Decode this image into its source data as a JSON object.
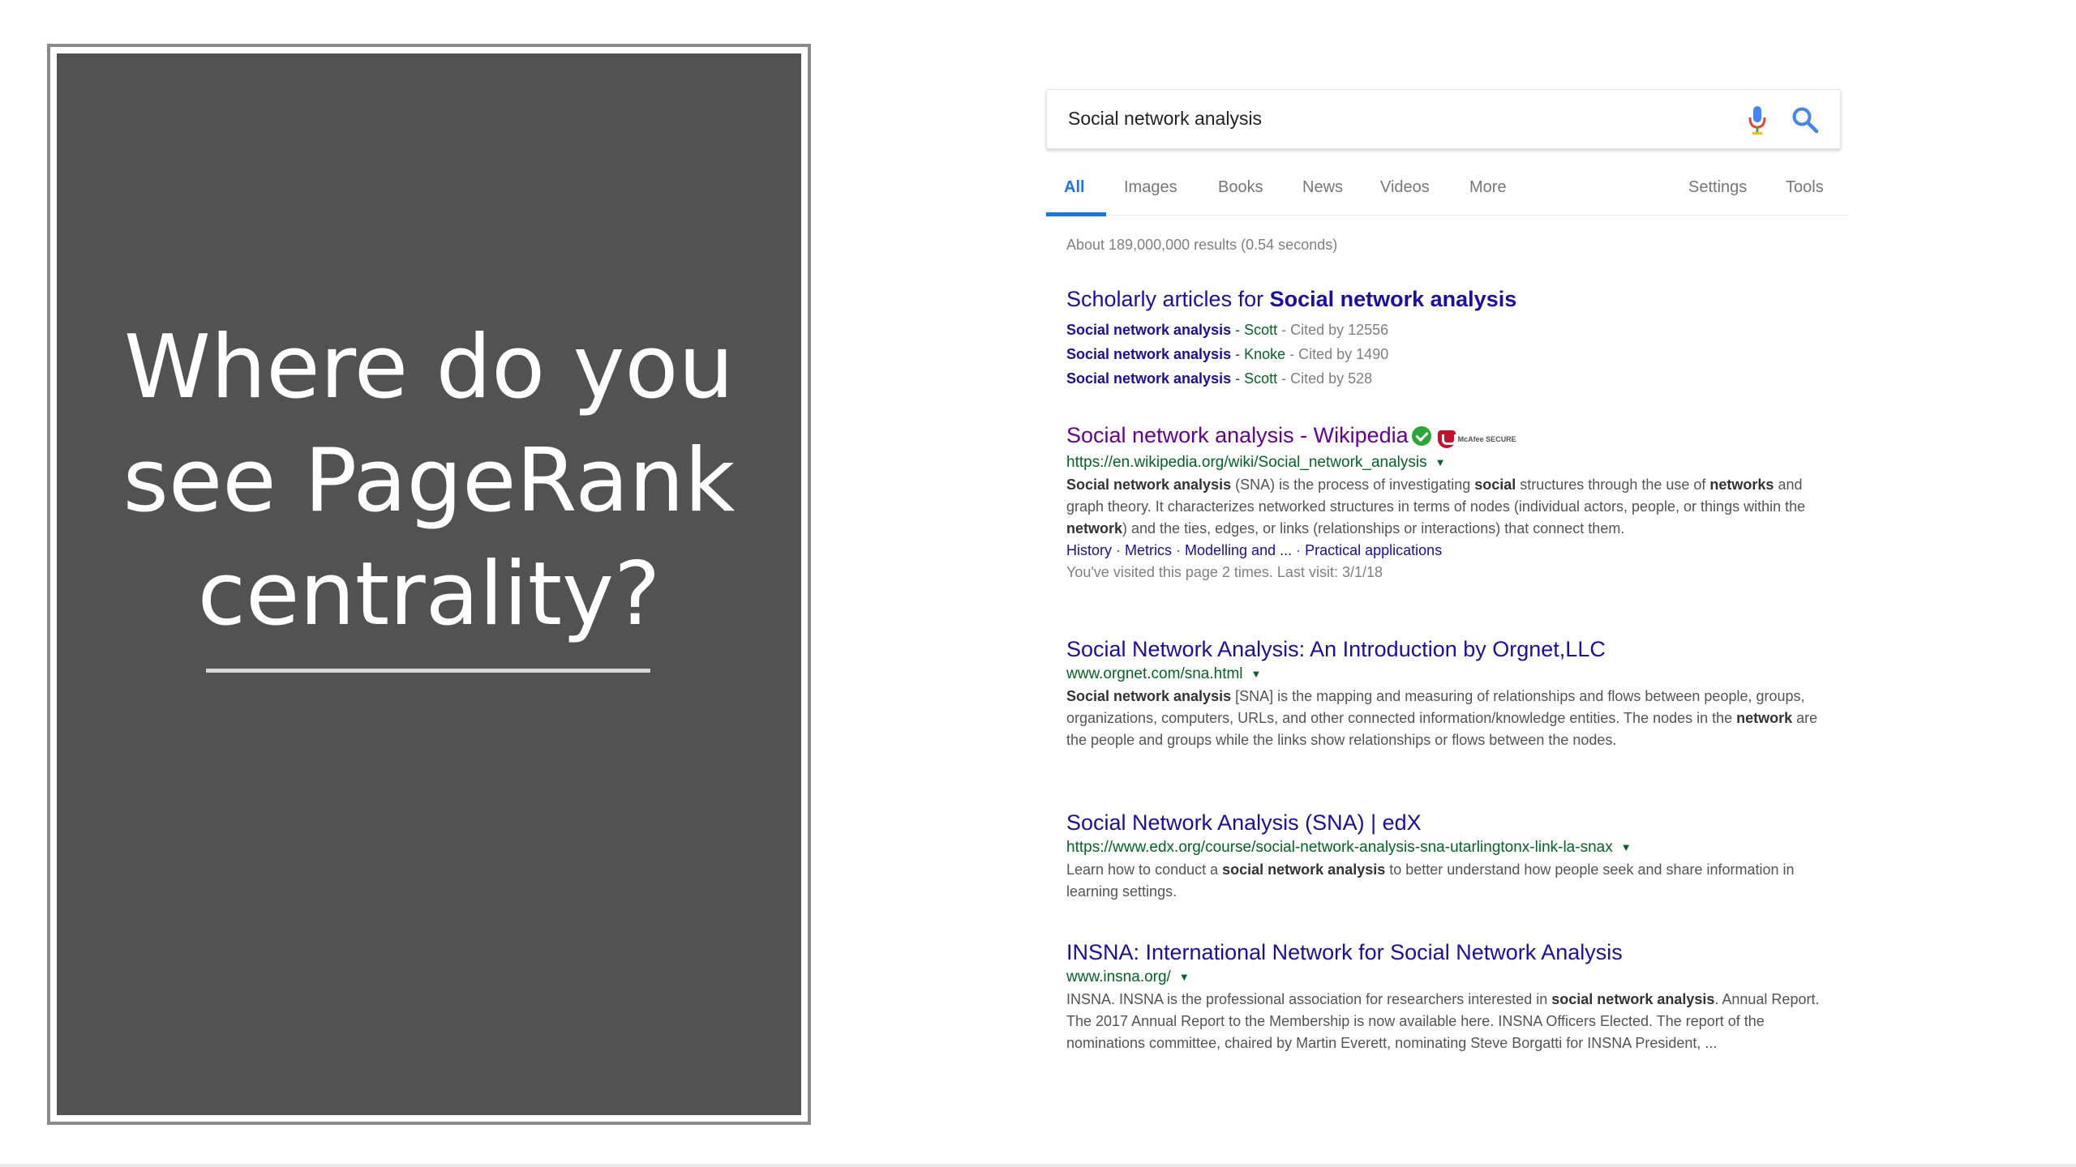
{
  "slide": {
    "title_lines": [
      "Where do you",
      "see PageRank",
      "centrality?"
    ]
  },
  "search": {
    "query": "Social network analysis",
    "mic_icon": "microphone-icon",
    "search_icon": "magnifier-icon",
    "colors": {
      "blue": "#4285f4",
      "accent": "#1a73e8"
    }
  },
  "tabs": {
    "all": "All",
    "images": "Images",
    "books": "Books",
    "news": "News",
    "videos": "Videos",
    "more": "More",
    "settings": "Settings",
    "tools": "Tools"
  },
  "result_stats": "About 189,000,000 results (0.54 seconds)",
  "scholarly": {
    "title_prefix": "Scholarly articles for ",
    "title_bold": "Social network analysis",
    "items": [
      {
        "title": "Social network analysis",
        "author": " - Scott",
        "cited": " - Cited by 12556"
      },
      {
        "title": "Social network analysis",
        "author": " - Knoke",
        "cited": " - Cited by 1490"
      },
      {
        "title": "Social network analysis",
        "author": " - Scott",
        "cited": " - Cited by 528"
      }
    ]
  },
  "wikipedia": {
    "title": "Social network analysis - Wikipedia",
    "mcafee_text": "McAfee SECURE",
    "url": "https://en.wikipedia.org/wiki/Social_network_analysis",
    "snippet": {
      "b1": "Social network analysis",
      "t1": " (SNA) is the process of investigating ",
      "b2": "social",
      "t2": " structures through the use of ",
      "b3": "networks",
      "t3": " and graph theory. It characterizes networked structures in terms of nodes (individual actors, people, or things within the ",
      "b4": "network",
      "t4": ") and the ties, edges, or links (relationships or interactions) that connect them."
    },
    "links": [
      "History",
      "Metrics",
      "Modelling and ...",
      "Practical applications"
    ],
    "link_sep": " · ",
    "visited": "You've visited this page 2 times. Last visit: 3/1/18"
  },
  "orgnet": {
    "title": "Social Network Analysis: An Introduction by Orgnet,LLC",
    "url": "www.orgnet.com/sna.html",
    "snippet": {
      "b1": "Social network analysis",
      "t1": " [SNA] is the mapping and measuring of relationships and flows between people, groups, organizations, computers, URLs, and other connected information/knowledge entities. The nodes in the ",
      "b2": "network",
      "t2": " are the people and groups while the links show relationships or flows between the nodes."
    }
  },
  "edx": {
    "title": "Social Network Analysis (SNA) | edX",
    "url": "https://www.edx.org/course/social-network-analysis-sna-utarlingtonx-link-la-snax",
    "snippet": {
      "t1": "Learn how to conduct a ",
      "b1": "social network analysis",
      "t2": " to better understand how people seek and share information in learning settings."
    }
  },
  "insna": {
    "title": "INSNA: International Network for Social Network Analysis",
    "url": "www.insna.org/",
    "snippet": {
      "t1": "INSNA. INSNA is the professional association for researchers interested in ",
      "b1": "social network analysis",
      "t2": ". Annual Report. The 2017 Annual Report to the Membership is now available here. INSNA Officers Elected. The report of the nominations committee, chaired by Martin Everett, nominating Steve Borgatti for INSNA President, ..."
    }
  },
  "caret": "▼"
}
